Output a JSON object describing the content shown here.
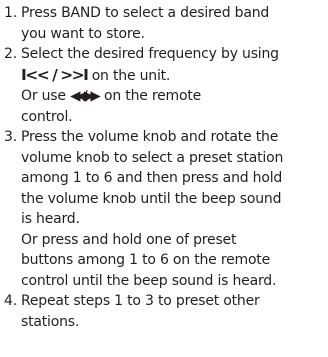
{
  "steps": [
    {
      "number": "1.",
      "lines": [
        "Press BAND to select a desired band",
        "you want to store."
      ]
    },
    {
      "number": "2.",
      "lines": {
        "l1": "Select the desired frequency by using",
        "l2_symbols": "I<< / >>I",
        "l2_rest": " on the unit.",
        "l3_pre": "Or use ",
        "l3_symbols": "◀◀ / ▶▶",
        "l3_rest": " on the remote",
        "l4": "control."
      }
    },
    {
      "number": "3.",
      "lines": [
        "Press the volume knob and rotate the",
        "volume knob to select a preset station",
        "among 1 to 6 and then press and hold",
        "the volume knob until the beep sound",
        "is heard.",
        "Or press and hold one of preset",
        "buttons among 1 to 6 on the remote",
        "control until the beep sound is heard."
      ]
    },
    {
      "number": "4.",
      "lines": [
        "Repeat steps 1 to 3 to preset other",
        "stations."
      ]
    }
  ]
}
